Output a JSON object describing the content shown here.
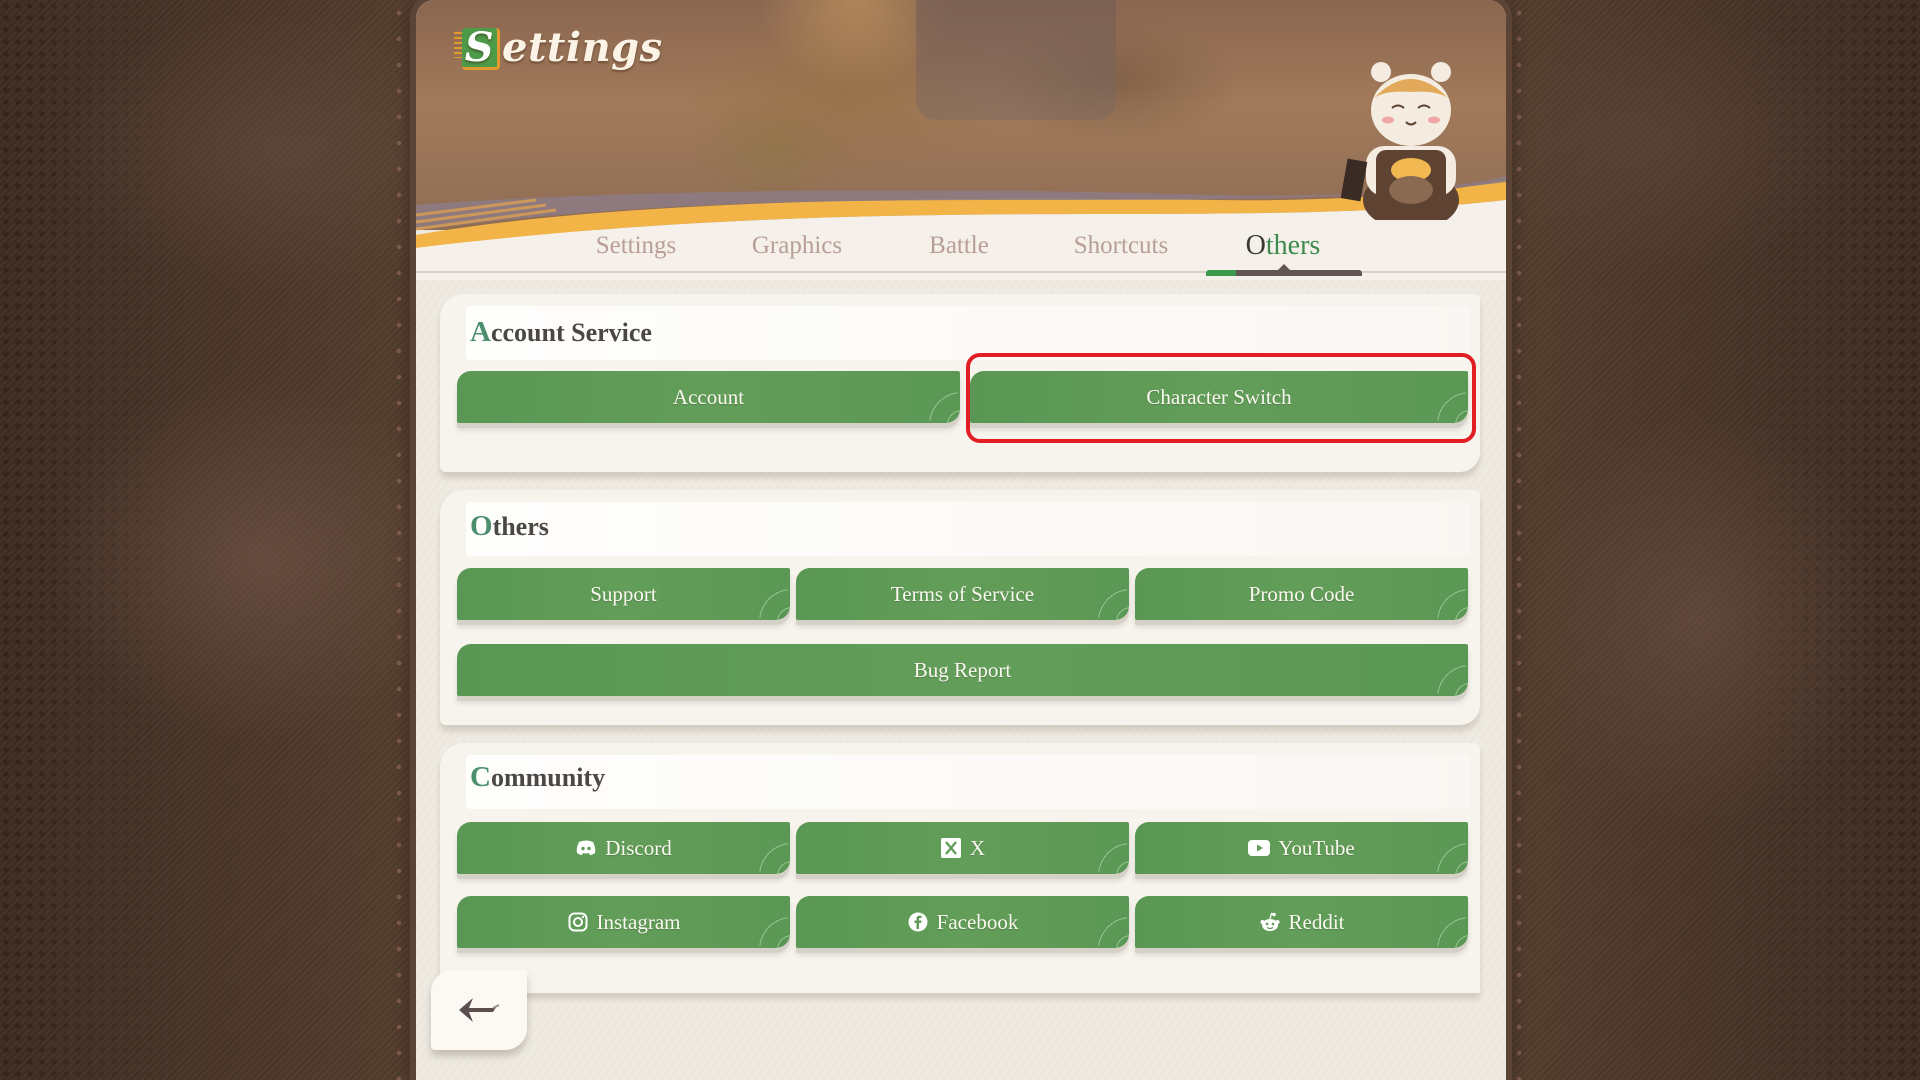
{
  "window": {
    "title_initial": "S",
    "title_rest": "ettings"
  },
  "tabs": [
    {
      "label": "Settings",
      "active": false
    },
    {
      "label": "Graphics",
      "active": false
    },
    {
      "label": "Battle",
      "active": false
    },
    {
      "label": "Shortcuts",
      "active": false
    },
    {
      "label_first": "O",
      "label_rest": "thers",
      "label": "Others",
      "active": true
    }
  ],
  "sections": {
    "account_service": {
      "title_first": "A",
      "title_rest": "ccount Service",
      "buttons": [
        {
          "label": "Account"
        },
        {
          "label": "Character Switch",
          "highlighted": true
        }
      ]
    },
    "others": {
      "title_first": "O",
      "title_rest": "thers",
      "buttons": [
        {
          "label": "Support"
        },
        {
          "label": "Terms of Service"
        },
        {
          "label": "Promo Code"
        },
        {
          "label": "Bug Report"
        }
      ]
    },
    "community": {
      "title_first": "C",
      "title_rest": "ommunity",
      "buttons": [
        {
          "label": "Discord",
          "icon": "discord-icon"
        },
        {
          "label": "X",
          "icon": "x-icon"
        },
        {
          "label": "YouTube",
          "icon": "youtube-icon"
        },
        {
          "label": "Instagram",
          "icon": "instagram-icon"
        },
        {
          "label": "Facebook",
          "icon": "facebook-icon"
        },
        {
          "label": "Reddit",
          "icon": "reddit-icon"
        }
      ]
    }
  },
  "back_button": {
    "icon": "back-arrow-icon"
  },
  "colors": {
    "button_green": "#5f9b57",
    "accent_green": "#3c9a4e",
    "highlight_red": "#e01e24",
    "panel_bg": "#efebe2",
    "tab_inactive": "#b79e96",
    "tab_active": "#3d3a36"
  }
}
